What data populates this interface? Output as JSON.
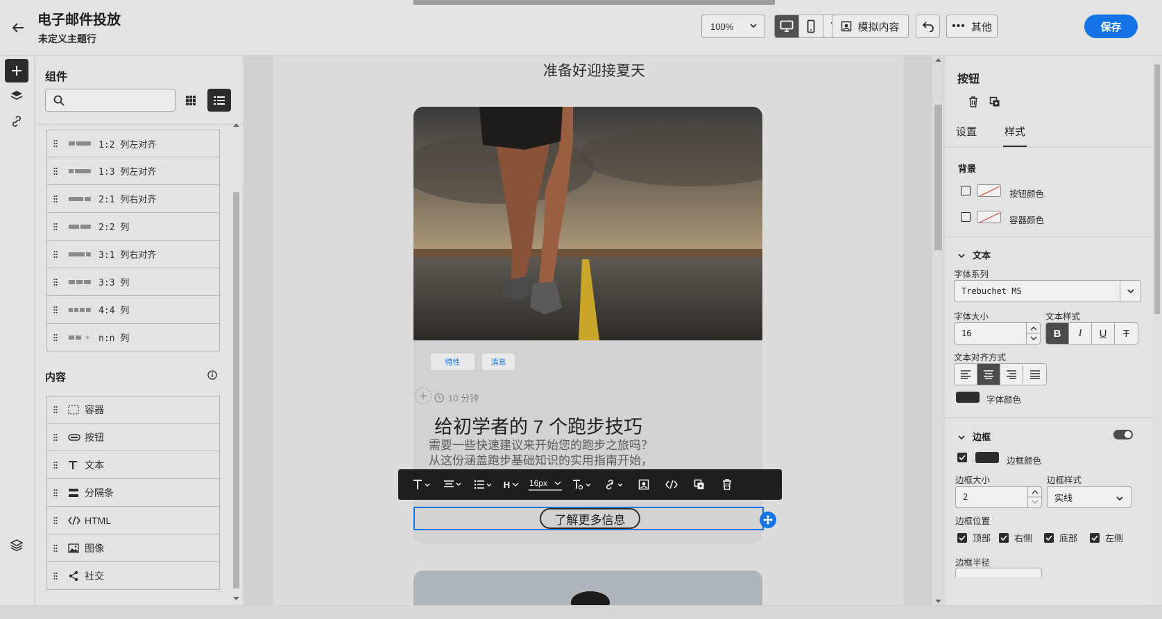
{
  "header": {
    "title": "电子邮件投放",
    "subtitle": "未定义主题行",
    "zoom": "100%",
    "simulate_label": "模拟内容",
    "more_label": "其他",
    "save_label": "保存"
  },
  "components": {
    "title": "组件",
    "search_placeholder": "",
    "structure_items": [
      {
        "label": "1:2 列左对齐"
      },
      {
        "label": "1:3 列左对齐"
      },
      {
        "label": "2:1 列右对齐"
      },
      {
        "label": "2:2 列"
      },
      {
        "label": "3:1 列右对齐"
      },
      {
        "label": "3:3 列"
      },
      {
        "label": "4:4 列"
      },
      {
        "label": "n:n 列"
      }
    ],
    "content_title": "内容",
    "content_items": [
      {
        "label": "容器",
        "icon": "container-icon"
      },
      {
        "label": "按钮",
        "icon": "button-icon"
      },
      {
        "label": "文本",
        "icon": "text-icon"
      },
      {
        "label": "分隔条",
        "icon": "divider-icon"
      },
      {
        "label": "HTML",
        "icon": "html-icon"
      },
      {
        "label": "图像",
        "icon": "image-icon"
      },
      {
        "label": "社交",
        "icon": "share-icon"
      }
    ]
  },
  "canvas": {
    "hero_title": "准备好迎接夏天",
    "tags": [
      "特性",
      "消息"
    ],
    "read_time": "10 分钟",
    "card_heading": "给初学者的 7 个跑步技巧",
    "card_desc_line1": "需要一些快速建议来开始您的跑步之旅吗？",
    "card_desc_line2": "从这份涵盖跑步基础知识的实用指南开始，",
    "toolbar_font_size": "16px",
    "cta_label": "了解更多信息"
  },
  "properties": {
    "title": "按钮",
    "tabs": [
      "设置",
      "样式"
    ],
    "active_tab": "样式",
    "background_label": "背景",
    "button_color_label": "按钮颜色",
    "container_color_label": "容器颜色",
    "text_section": "文本",
    "font_family_label": "字体系列",
    "font_family_value": "Trebuchet MS",
    "font_size_label": "字体大小",
    "font_size_value": "16",
    "text_style_label": "文本样式",
    "text_align_label": "文本对齐方式",
    "font_color_label": "字体颜色",
    "border_section": "边框",
    "border_color_label": "边框颜色",
    "border_size_label": "边框大小",
    "border_size_value": "2",
    "border_style_label": "边框样式",
    "border_style_value": "实线",
    "border_position_label": "边框位置",
    "positions": [
      "顶部",
      "右侧",
      "底部",
      "左侧"
    ],
    "border_radius_label": "边框半径"
  },
  "colors": {
    "accent": "#1473e6",
    "dark": "#2c2c2c"
  }
}
